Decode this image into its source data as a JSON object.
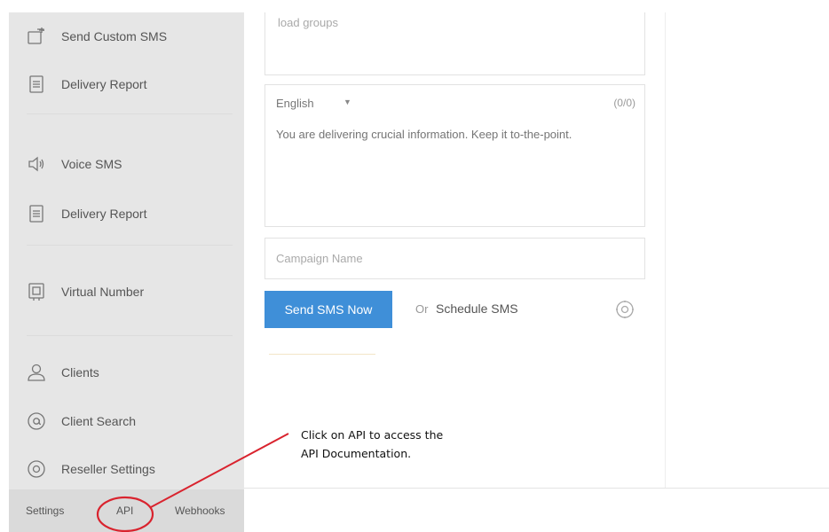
{
  "sidebar": {
    "items": [
      {
        "label": "Send Custom SMS",
        "icon": "edit-icon"
      },
      {
        "label": "Delivery Report",
        "icon": "document-icon"
      },
      {
        "label": "Voice SMS",
        "icon": "speaker-icon"
      },
      {
        "label": "Delivery Report",
        "icon": "document-icon"
      },
      {
        "label": "Virtual Number",
        "icon": "phone-box-icon"
      },
      {
        "label": "Clients",
        "icon": "user-icon"
      },
      {
        "label": "Client Search",
        "icon": "at-icon"
      },
      {
        "label": "Reseller Settings",
        "icon": "gear-icon"
      }
    ]
  },
  "bottom_bar": {
    "settings": "Settings",
    "api": "API",
    "webhooks": "Webhooks"
  },
  "form": {
    "groups_placeholder": "load groups",
    "language": "English",
    "counter": "(0/0)",
    "message_placeholder": "You are delivering crucial information. Keep it to-the-point.",
    "campaign_placeholder": "Campaign Name",
    "send_label": "Send SMS Now",
    "or_label": "Or",
    "schedule_label": "Schedule SMS"
  },
  "annotation": {
    "line1": "Click on API to access the",
    "line2": "API Documentation.",
    "color": "#d9232e"
  },
  "colors": {
    "primary": "#3f8fd8",
    "sidebar_bg": "#e6e6e6"
  }
}
